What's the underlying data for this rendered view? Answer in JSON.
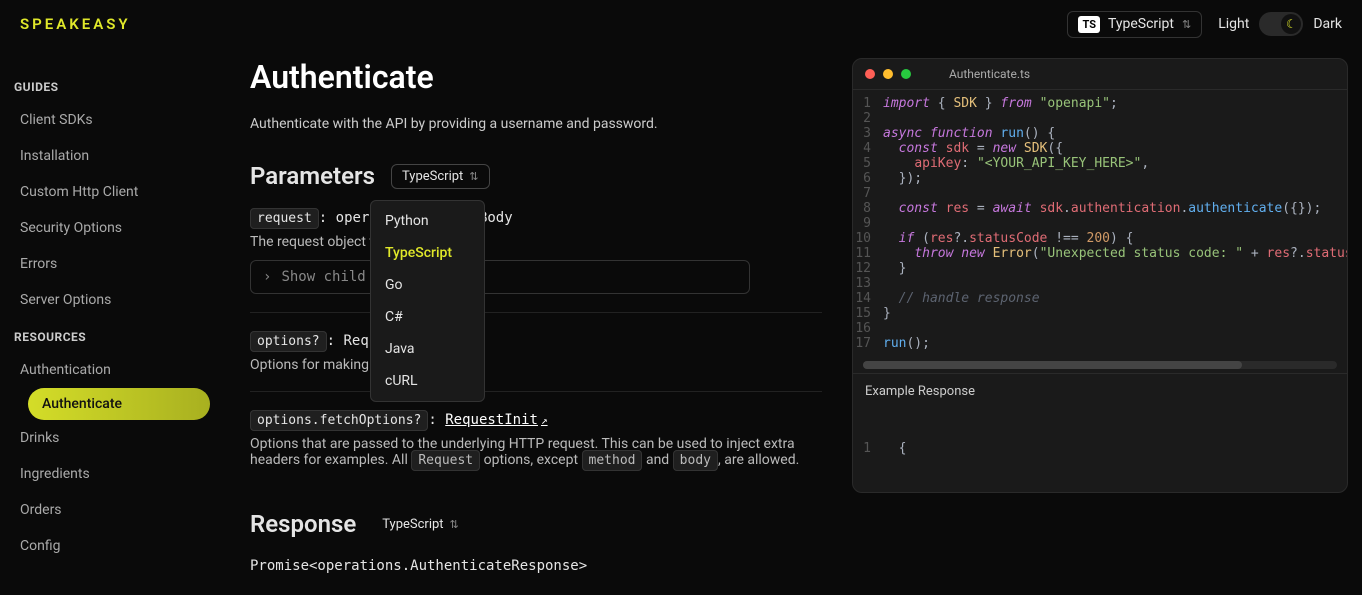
{
  "brand": "SPEAKEASY",
  "topbar": {
    "lang_badge": "TS",
    "lang_label": "TypeScript",
    "light_label": "Light",
    "dark_label": "Dark"
  },
  "sidebar": {
    "guides_heading": "GUIDES",
    "guides": [
      "Client SDKs",
      "Installation",
      "Custom Http Client",
      "Security Options",
      "Errors",
      "Server Options"
    ],
    "resources_heading": "RESOURCES",
    "resources": [
      "Authentication",
      "Authenticate",
      "Drinks",
      "Ingredients",
      "Orders",
      "Config"
    ],
    "active_index": 1
  },
  "page": {
    "title": "Authenticate",
    "lead": "Authenticate with the API by providing a username and password.",
    "parameters_heading": "Parameters",
    "response_heading": "Response",
    "response_type": "Promise<operations.AuthenticateResponse>",
    "lang_pill": "TypeScript",
    "dropdown": [
      "Python",
      "TypeScript",
      "Go",
      "C#",
      "Java",
      "cURL"
    ],
    "dropdown_selected": "TypeScript",
    "params": [
      {
        "name": "request",
        "type": "operat    ateRequestBody",
        "desc_prefix": "The request object t",
        "desc_suffix": "st.",
        "expand": "Show child"
      },
      {
        "name": "options?",
        "type": "Reque",
        "desc": "Options for making H"
      },
      {
        "name": "options.fetchOptions?",
        "link": "RequestInit",
        "desc_parts": {
          "a": "Options that are passed to the underlying HTTP request. This can be used to inject extra headers for examples. All ",
          "b": "Request",
          "c": " options, except ",
          "d": "method",
          "e": " and ",
          "f": "body",
          "g": ", are allowed."
        }
      }
    ]
  },
  "code": {
    "filename": "Authenticate.ts",
    "example_response_label": "Example Response",
    "lines": [
      [
        [
          "kw",
          "import"
        ],
        [
          "pu",
          " { "
        ],
        [
          "ty",
          "SDK"
        ],
        [
          "pu",
          " } "
        ],
        [
          "kw",
          "from"
        ],
        [
          "pu",
          " "
        ],
        [
          "str",
          "\"openapi\""
        ],
        [
          "pu",
          ";"
        ]
      ],
      [],
      [
        [
          "kw",
          "async"
        ],
        [
          "pu",
          " "
        ],
        [
          "kw",
          "function"
        ],
        [
          "pu",
          " "
        ],
        [
          "fn",
          "run"
        ],
        [
          "pu",
          "() {"
        ]
      ],
      [
        [
          "pu",
          "  "
        ],
        [
          "kw",
          "const"
        ],
        [
          "pu",
          " "
        ],
        [
          "id",
          "sdk"
        ],
        [
          "pu",
          " = "
        ],
        [
          "kw",
          "new"
        ],
        [
          "pu",
          " "
        ],
        [
          "ty",
          "SDK"
        ],
        [
          "pu",
          "({"
        ]
      ],
      [
        [
          "pu",
          "    "
        ],
        [
          "id",
          "apiKey"
        ],
        [
          "pu",
          ": "
        ],
        [
          "str",
          "\"<YOUR_API_KEY_HERE>\""
        ],
        [
          "pu",
          ","
        ]
      ],
      [
        [
          "pu",
          "  });"
        ]
      ],
      [],
      [
        [
          "pu",
          "  "
        ],
        [
          "kw",
          "const"
        ],
        [
          "pu",
          " "
        ],
        [
          "id",
          "res"
        ],
        [
          "pu",
          " = "
        ],
        [
          "kw",
          "await"
        ],
        [
          "pu",
          " "
        ],
        [
          "id",
          "sdk"
        ],
        [
          "pu",
          "."
        ],
        [
          "id",
          "authentication"
        ],
        [
          "pu",
          "."
        ],
        [
          "fn",
          "authenticate"
        ],
        [
          "pu",
          "({});"
        ]
      ],
      [],
      [
        [
          "pu",
          "  "
        ],
        [
          "kw",
          "if"
        ],
        [
          "pu",
          " ("
        ],
        [
          "id",
          "res"
        ],
        [
          "pu",
          "?."
        ],
        [
          "id",
          "statusCode"
        ],
        [
          "pu",
          " !== "
        ],
        [
          "num",
          "200"
        ],
        [
          "pu",
          ") {"
        ]
      ],
      [
        [
          "pu",
          "    "
        ],
        [
          "kw",
          "throw"
        ],
        [
          "pu",
          " "
        ],
        [
          "kw",
          "new"
        ],
        [
          "pu",
          " "
        ],
        [
          "ty",
          "Error"
        ],
        [
          "pu",
          "("
        ],
        [
          "str",
          "\"Unexpected status code: \""
        ],
        [
          "pu",
          " + "
        ],
        [
          "id",
          "res"
        ],
        [
          "pu",
          "?."
        ],
        [
          "id",
          "status"
        ]
      ],
      [
        [
          "pu",
          "  }"
        ]
      ],
      [],
      [
        [
          "pu",
          "  "
        ],
        [
          "cm",
          "// handle response"
        ]
      ],
      [
        [
          "pu",
          "}"
        ]
      ],
      [],
      [
        [
          "fn",
          "run"
        ],
        [
          "pu",
          "();"
        ]
      ]
    ],
    "json_response": "  {"
  }
}
